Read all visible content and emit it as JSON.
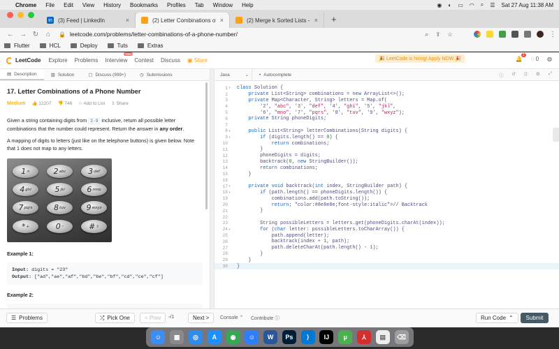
{
  "menubar": {
    "app": "Chrome",
    "items": [
      "File",
      "Edit",
      "View",
      "History",
      "Bookmarks",
      "Profiles",
      "Tab",
      "Window",
      "Help"
    ],
    "datetime": "Sat 27 Aug  11:38 AM"
  },
  "tabs": [
    {
      "title": "(3) Feed | LinkedIn",
      "icon": "linkedin-icon",
      "color": "#0a66c2",
      "active": false
    },
    {
      "title": "(2) Letter Combinations of a P",
      "icon": "leetcode-icon",
      "color": "#ffa116",
      "active": true
    },
    {
      "title": "(2) Merge k Sorted Lists - Leet",
      "icon": "leetcode-icon",
      "color": "#ffa116",
      "active": false
    }
  ],
  "toolbar": {
    "url": "leetcode.com/problems/letter-combinations-of-a-phone-number/"
  },
  "bookmarks": [
    "Flutter",
    "HCL",
    "Deploy",
    "Tuts",
    "Extras"
  ],
  "lcnav": {
    "logo": "LeetCode",
    "links": [
      "Explore",
      "Problems",
      "Interview",
      "Contest",
      "Discuss",
      "Store"
    ],
    "interview_badge": "New",
    "promo": "🎉 LeetCode is hiring! Apply NOW.🎉",
    "notif_count": "3",
    "coins": "0"
  },
  "leftTabs": [
    "Description",
    "Solution",
    "Discuss (999+)",
    "Submissions"
  ],
  "editorBar": {
    "language": "Java",
    "autocomplete": "Autocomplete"
  },
  "problem": {
    "title": "17. Letter Combinations of a Phone Number",
    "difficulty": "Medium",
    "likes": "12207",
    "dislikes": "746",
    "add_to_list": "Add to List",
    "share": "Share",
    "desc1_pre": "Given a string containing digits from ",
    "desc1_code": "2-9",
    "desc1_mid": " inclusive, return all possible letter combinations that the number could represent. Return the answer in ",
    "desc1_bold": "any order",
    "desc1_end": ".",
    "desc2": "A mapping of digits to letters (just like on the telephone buttons) is given below. Note that 1 does not map to any letters.",
    "keypad": [
      {
        "n": "1",
        "l": "∞"
      },
      {
        "n": "2",
        "l": "abc"
      },
      {
        "n": "3",
        "l": "def"
      },
      {
        "n": "4",
        "l": "ghi"
      },
      {
        "n": "5",
        "l": "jkl"
      },
      {
        "n": "6",
        "l": "mno"
      },
      {
        "n": "7",
        "l": "pqrs"
      },
      {
        "n": "8",
        "l": "tuv"
      },
      {
        "n": "9",
        "l": "wxyz"
      },
      {
        "n": "*",
        "l": "+"
      },
      {
        "n": "0",
        "l": "⌣"
      },
      {
        "n": "#",
        "l": "⇧"
      }
    ],
    "example1_title": "Example 1:",
    "example1_input_label": "Input:",
    "example1_input": " digits = \"23\"",
    "example1_output_label": "Output:",
    "example1_output": " [\"ad\",\"ae\",\"af\",\"bd\",\"be\",\"bf\",\"cd\",\"ce\",\"cf\"]",
    "example2_title": "Example 2:"
  },
  "code": [
    "class Solution {",
    "    private List<String> combinations = new ArrayList<>();",
    "    private Map<Character, String> letters = Map.of(",
    "        '2', \"abc\", '3', \"def\", '4', \"ghi\", '5', \"jkl\",",
    "        '6', \"mno\", '7', \"pqrs\", '8', \"tuv\", '9', \"wxyz\");",
    "    private String phoneDigits;",
    "",
    "    public List<String> letterCombinations(String digits) {",
    "        if (digits.length() == 0) {",
    "            return combinations;",
    "        }",
    "        phoneDigits = digits;",
    "        backtrack(0, new StringBuilder());",
    "        return combinations;",
    "    }",
    "",
    "    private void backtrack(int index, StringBuilder path) {",
    "        if (path.length() == phoneDigits.length()) {",
    "            combinations.add(path.toString());",
    "            return; // Backtrack",
    "        }",
    "",
    "        String possibleLetters = letters.get(phoneDigits.charAt(index));",
    "        for (char letter: possibleLetters.toCharArray()) {",
    "            path.append(letter);",
    "            backtrack(index + 1, path);",
    "            path.deleteCharAt(path.length() - 1);",
    "        }",
    "    }",
    "}"
  ],
  "bottom": {
    "problems": "Problems",
    "pick_one": "Pick One",
    "prev": "< Prev",
    "page": "/1",
    "next": "Next >",
    "console": "Console",
    "contribute": "Contribute",
    "run_code": "Run Code",
    "submit": "Submit"
  },
  "dock": [
    {
      "name": "finder-icon",
      "color": "#3d8ef0"
    },
    {
      "name": "launchpad-icon",
      "color": "#8a8a8a"
    },
    {
      "name": "safari-icon",
      "color": "#2d8cf0"
    },
    {
      "name": "app-store-icon",
      "color": "#1e90ff"
    },
    {
      "name": "chrome-icon",
      "color": "#34a853"
    },
    {
      "name": "finder-2-icon",
      "color": "#2d7ff9"
    },
    {
      "name": "word-icon",
      "color": "#2b579a"
    },
    {
      "name": "photoshop-icon",
      "color": "#001e36"
    },
    {
      "name": "vscode-icon",
      "color": "#0078d4"
    },
    {
      "name": "intellij-icon",
      "color": "#000000"
    },
    {
      "name": "torrent-icon",
      "color": "#4caf50"
    },
    {
      "name": "acrobat-icon",
      "color": "#d32f2f"
    },
    {
      "name": "notes-icon",
      "color": "#eeeeee"
    },
    {
      "name": "trash-icon",
      "color": "#9e9e9e"
    }
  ]
}
